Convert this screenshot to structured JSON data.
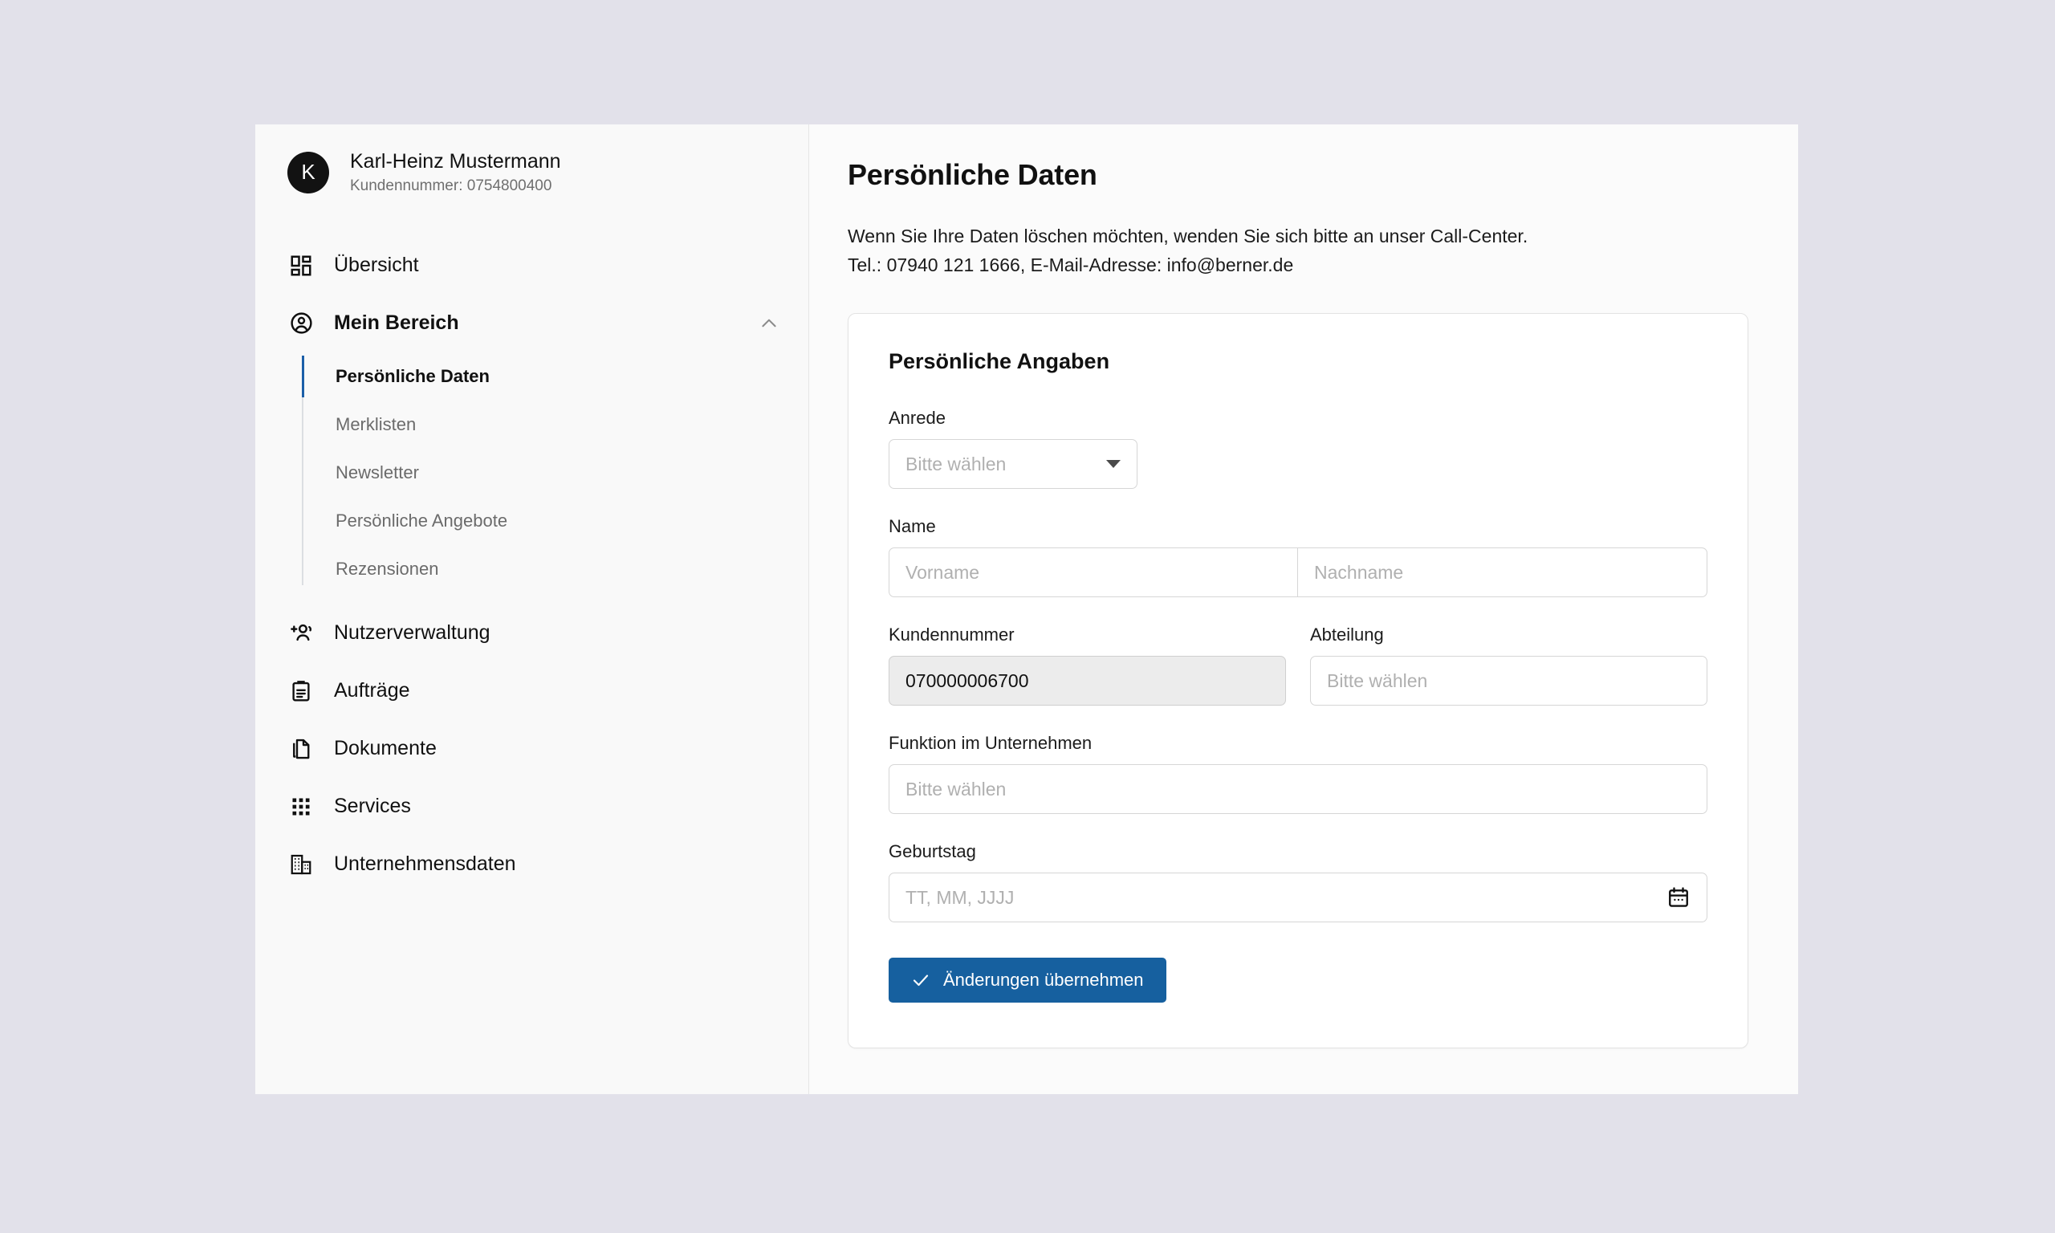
{
  "user": {
    "avatar_initial": "K",
    "name": "Karl-Heinz Mustermann",
    "customer_number_line": "Kundennummer: 0754800400"
  },
  "sidebar": {
    "items": [
      {
        "label": "Übersicht",
        "icon": "dashboard-grid-icon"
      },
      {
        "label": "Mein Bereich",
        "icon": "person-circle-icon",
        "chevron": "chevron-up-icon"
      },
      {
        "label": "Nutzerverwaltung",
        "icon": "user-add-icon"
      },
      {
        "label": "Aufträge",
        "icon": "clipboard-icon"
      },
      {
        "label": "Dokumente",
        "icon": "copy-documents-icon"
      },
      {
        "label": "Services",
        "icon": "apps-grid-icon"
      },
      {
        "label": "Unternehmensdaten",
        "icon": "building-icon"
      }
    ],
    "subitems": [
      {
        "label": "Persönliche Daten",
        "active": true
      },
      {
        "label": "Merklisten",
        "active": false
      },
      {
        "label": "Newsletter",
        "active": false
      },
      {
        "label": "Persönliche Angebote",
        "active": false
      },
      {
        "label": "Rezensionen",
        "active": false
      }
    ]
  },
  "main": {
    "title": "Persönliche Daten",
    "note_line_1": "Wenn Sie Ihre Daten löschen möchten, wenden Sie sich bitte an unser Call-Center.",
    "note_line_2": "Tel.: 07940 121 1666, E-Mail-Adresse: info@berner.de"
  },
  "form": {
    "card_title": "Persönliche Angaben",
    "anrede": {
      "label": "Anrede",
      "placeholder": "Bitte wählen",
      "value": ""
    },
    "name": {
      "label": "Name",
      "first_placeholder": "Vorname",
      "first_value": "",
      "last_placeholder": "Nachname",
      "last_value": ""
    },
    "kundennummer": {
      "label": "Kundennummer",
      "value": "070000006700",
      "disabled": true
    },
    "abteilung": {
      "label": "Abteilung",
      "placeholder": "Bitte wählen",
      "value": ""
    },
    "funktion": {
      "label": "Funktion im Unternehmen",
      "placeholder": "Bitte wählen",
      "value": ""
    },
    "geburtstag": {
      "label": "Geburtstag",
      "placeholder": "TT, MM, JJJJ",
      "value": "",
      "icon": "calendar-icon"
    },
    "submit": {
      "label": "Änderungen übernehmen",
      "icon": "check-icon"
    }
  },
  "colors": {
    "page_background": "#e2e1ea",
    "sidebar_background": "#f9f9f9",
    "accent_blue": "#16609f",
    "active_rail": "#1c5fa8",
    "avatar_background": "#121212",
    "disabled_field": "#ececec"
  }
}
